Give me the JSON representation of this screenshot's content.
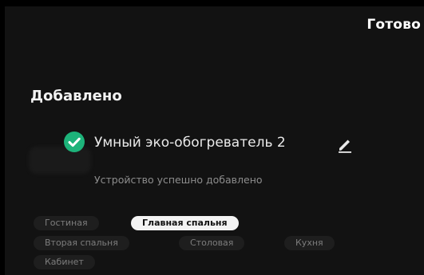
{
  "header": {
    "done_label": "Готово"
  },
  "section": {
    "title": "Добавлено"
  },
  "device": {
    "name": "Умный эко-обогреватель 2",
    "status": "Устройство успешно добавлено",
    "success_color": "#1DB37A"
  },
  "rooms": [
    {
      "label": "Гостиная",
      "selected": false
    },
    {
      "label": "Главная спальня",
      "selected": true
    },
    {
      "label": "Вторая спальня",
      "selected": false
    },
    {
      "label": "Столовая",
      "selected": false
    },
    {
      "label": "Кухня",
      "selected": false
    },
    {
      "label": "Кабинет",
      "selected": false
    }
  ],
  "icons": {
    "success": "check-circle-icon",
    "edit": "pencil-icon"
  }
}
